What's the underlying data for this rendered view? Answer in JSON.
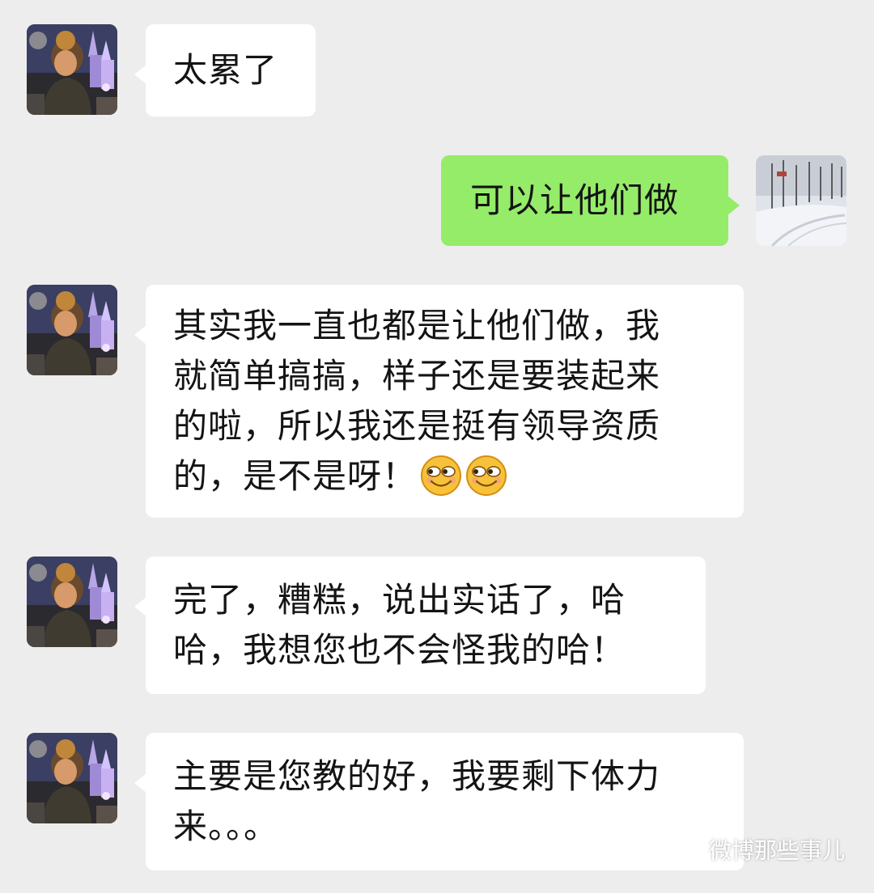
{
  "messages": [
    {
      "side": "in",
      "lines": [
        "太累了"
      ]
    },
    {
      "side": "out",
      "lines": [
        "可以让他们做"
      ]
    },
    {
      "side": "in",
      "lines": [
        "其实我一直也都是让他们做，我",
        "就简单搞搞，样子还是要装起来",
        "的啦，所以我还是挺有领导资质",
        "的，是不是呀！"
      ],
      "emoji": "smirk-face"
    },
    {
      "side": "in",
      "lines": [
        "完了，糟糕，说出实话了，哈",
        "哈，我想您也不会怪我的哈！"
      ]
    },
    {
      "side": "in",
      "lines": [
        "主要是您教的好，我要剩下体力",
        "来。。。"
      ]
    }
  ],
  "avatars": {
    "contact": "castle-night-avatar",
    "self": "snowy-forest-avatar"
  },
  "watermark": {
    "text": "微博那些事儿",
    "icon": "wechat-official-account-icon"
  },
  "colors": {
    "background": "#ededed",
    "incoming_bubble": "#ffffff",
    "outgoing_bubble": "#95ec69"
  }
}
